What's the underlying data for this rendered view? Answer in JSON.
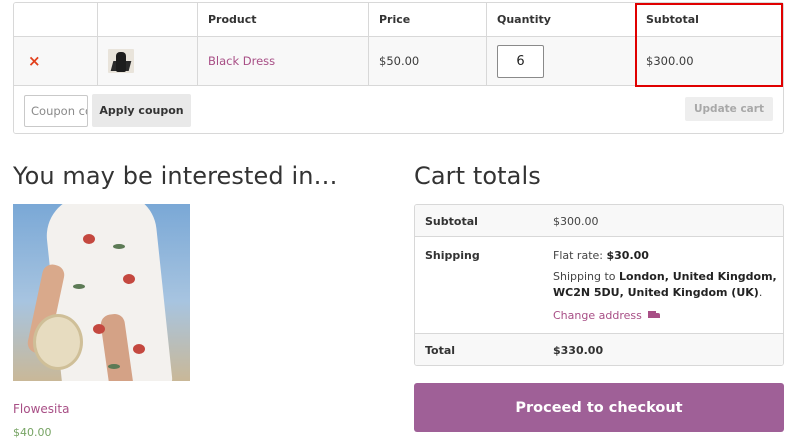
{
  "cart_table": {
    "headers": {
      "remove": "",
      "thumbnail": "",
      "product": "Product",
      "price": "Price",
      "quantity": "Quantity",
      "subtotal": "Subtotal"
    },
    "items": [
      {
        "remove_symbol": "×",
        "product_name": "Black Dress",
        "price": "$50.00",
        "quantity": "6",
        "subtotal": "$300.00"
      }
    ],
    "coupon": {
      "placeholder": "Coupon code",
      "apply_label": "Apply coupon"
    },
    "update_label": "Update cart"
  },
  "interested": {
    "title": "You may be interested in…",
    "products": [
      {
        "name": "Flowesita",
        "price": "$40.00"
      }
    ]
  },
  "totals": {
    "title": "Cart totals",
    "subtotal_label": "Subtotal",
    "subtotal_value": "$300.00",
    "shipping_label": "Shipping",
    "flat_rate_prefix": "Flat rate: ",
    "flat_rate_value": "$30.00",
    "shipping_to_prefix": "Shipping to ",
    "shipping_to_address": "London, United Kingdom, WC2N 5DU, United Kingdom (UK)",
    "shipping_to_suffix": ".",
    "change_address": "Change address",
    "total_label": "Total",
    "total_value": "$330.00"
  },
  "checkout_label": "Proceed to checkout",
  "colors": {
    "accent": "#a84f86",
    "checkout": "#9f6097",
    "highlight": "#e00000",
    "remove": "#e2401c",
    "price_green": "#77a464"
  }
}
